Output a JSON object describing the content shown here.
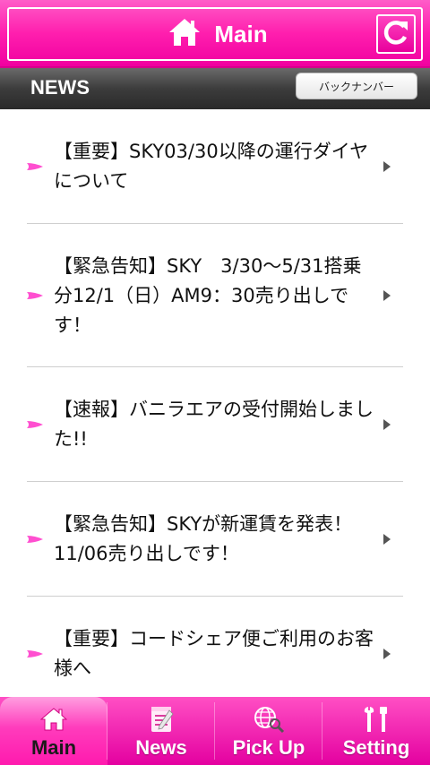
{
  "header": {
    "title": "Main",
    "home_icon": "home-icon",
    "refresh_icon": "refresh-icon"
  },
  "newsbar": {
    "title": "NEWS",
    "backnumber_label": "バックナンバー"
  },
  "news": [
    {
      "text": "【重要】SKY03/30以降の運行ダイヤについて"
    },
    {
      "text": "【緊急告知】SKY　3/30～5/31搭乗分12/1（日）AM9：30売り出しです！"
    },
    {
      "text": "【速報】バニラエアの受付開始しました!!"
    },
    {
      "text": "【緊急告知】SKYが新運賃を発表！11/06売り出しです！"
    },
    {
      "text": "【重要】コードシェア便ご利用のお客様へ"
    }
  ],
  "tabs": [
    {
      "label": "Main",
      "icon": "home-icon",
      "active": true
    },
    {
      "label": "News",
      "icon": "notepad-icon",
      "active": false
    },
    {
      "label": "Pick Up",
      "icon": "globe-search-icon",
      "active": false
    },
    {
      "label": "Setting",
      "icon": "tools-icon",
      "active": false
    }
  ],
  "colors": {
    "brand_pink": "#ff1fae",
    "bar_dark": "#3c3c3c",
    "bullet_pink": "#ff4fd0"
  }
}
